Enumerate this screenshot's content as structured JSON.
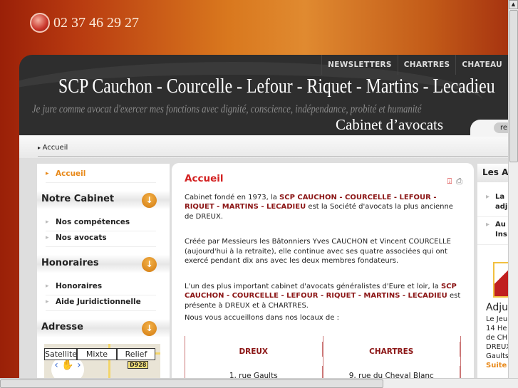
{
  "header": {
    "phone": "02 37 46 29 27",
    "nav": [
      "NEWSLETTERS",
      "CHARTRES",
      "CHATEAU"
    ],
    "title": "SCP Cauchon - Courcelle - Lefour - Riquet - Martins - Lecadieu",
    "motto": "Je jure comme avocat d'exercer mes fonctions avec dignité, conscience, indépendance, probité et humanité",
    "subtitle": "Cabinet d’avocats",
    "search_label": "re"
  },
  "breadcrumb": "Accueil",
  "sidebar": {
    "home": "Accueil",
    "sections": [
      {
        "title": "Notre Cabinet",
        "items": [
          "Nos compétences",
          "Nos avocats"
        ]
      },
      {
        "title": "Honoraires",
        "items": [
          "Honoraires",
          "Aide Juridictionnelle"
        ]
      },
      {
        "title": "Adresse",
        "items": []
      }
    ],
    "map": {
      "buttons": [
        "Satellite",
        "Mixte",
        "Relief"
      ],
      "road": "D928"
    }
  },
  "main": {
    "title": "Accueil",
    "p1": {
      "a": "Cabinet fondé en 1973, la ",
      "b": "SCP CAUCHON - COURCELLE - LEFOUR - RIQUET - MARTINS - LECADIEU",
      "c": " est la Société d'avocats la plus ancienne de DREUX."
    },
    "p2": "Créée par Messieurs les Bâtonniers Yves CAUCHON et Vincent COURCELLE (aujourd'hui à la retraite), elle continue avec ses quatre associées qui ont exercé pendant dix ans avec les deux membres fondateurs.",
    "p3": {
      "a": "L'un des plus important cabinet d'avocats généralistes d'Eure et loir, la ",
      "b": "SCP CAUCHON - COURCELLE - LEFOUR - RIQUET - MARTINS - LECADIEU",
      "c": " est présente à DREUX et à CHARTRES."
    },
    "p4": "Nous vous accueillons dans nos locaux de :",
    "offices": [
      {
        "city": "DREUX",
        "address": "1, rue Gaults"
      },
      {
        "city": "CHARTRES",
        "address": "9, rue du Cheval Blanc"
      }
    ]
  },
  "right": {
    "title": "Les A",
    "items": [
      [
        "La",
        "adj"
      ],
      [
        "Au",
        "Ins"
      ]
    ],
    "heading": "Adju",
    "text": [
      "Le Jeu",
      "14 He",
      "de CH",
      "DREUX",
      "Gaults"
    ],
    "more": "Suite"
  }
}
